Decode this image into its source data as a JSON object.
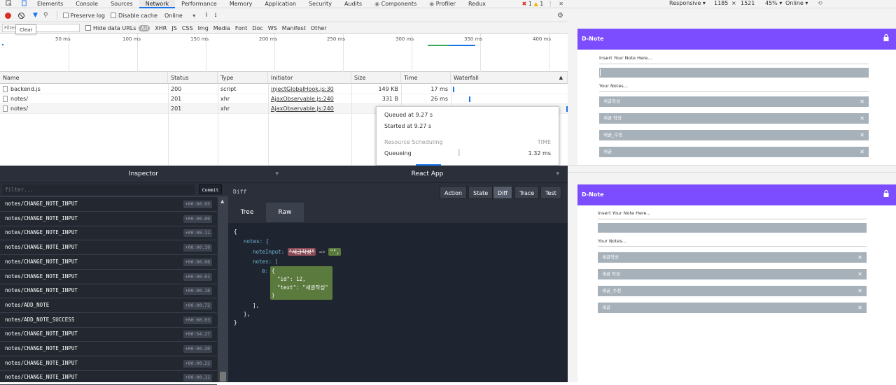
{
  "devtools": {
    "tabs": [
      "Elements",
      "Console",
      "Sources",
      "Network",
      "Performance",
      "Memory",
      "Application",
      "Security",
      "Audits",
      "Components",
      "Profiler",
      "Redux"
    ],
    "active_tab": "Network",
    "errors": "1",
    "warnings": "1",
    "toolbar": {
      "preserve_log": "Preserve log",
      "disable_cache": "Disable cache",
      "throttle": "Online",
      "clear_tooltip": "Clear"
    },
    "filter": {
      "placeholder": "Filter",
      "hide_data_urls": "Hide data URLs",
      "types": [
        "All",
        "XHR",
        "JS",
        "CSS",
        "Img",
        "Media",
        "Font",
        "Doc",
        "WS",
        "Manifest",
        "Other"
      ]
    },
    "overview_ticks": [
      "50 ms",
      "100 ms",
      "150 ms",
      "200 ms",
      "250 ms",
      "300 ms",
      "350 ms",
      "400 ms"
    ],
    "columns": [
      "Name",
      "Status",
      "Type",
      "Initiator",
      "Size",
      "Time",
      "Waterfall"
    ],
    "rows": [
      {
        "name": "backend.js",
        "status": "200",
        "type": "script",
        "initiator": "injectGlobalHook.js:30",
        "size": "149 KB",
        "time": "17 ms"
      },
      {
        "name": "notes/",
        "status": "201",
        "type": "xhr",
        "initiator": "AjaxObservable.js:240",
        "size": "331 B",
        "time": "26 ms"
      },
      {
        "name": "notes/",
        "status": "201",
        "type": "xhr",
        "initiator": "AjaxObservable.js:240",
        "size": "",
        "time": ""
      }
    ],
    "tooltip": {
      "queued": "Queued at 9.27 s",
      "started": "Started at 9.27 s",
      "section": "Resource Scheduling",
      "time_label": "TIME",
      "queueing": "Queueing",
      "queueing_time": "1.32 ms"
    }
  },
  "redux": {
    "inspector_title": "Inspector",
    "app_title": "React App",
    "filter_placeholder": "filter...",
    "commit": "Commit",
    "actions": [
      {
        "name": "notes/CHANGE_NOTE_INPUT",
        "time": "+00:00.05"
      },
      {
        "name": "notes/CHANGE_NOTE_INPUT",
        "time": "+00:00.09"
      },
      {
        "name": "notes/CHANGE_NOTE_INPUT",
        "time": "+00:00.11"
      },
      {
        "name": "notes/CHANGE_NOTE_INPUT",
        "time": "+00:00.19"
      },
      {
        "name": "notes/CHANGE_NOTE_INPUT",
        "time": "+00:00.08"
      },
      {
        "name": "notes/CHANGE_NOTE_INPUT",
        "time": "+00:00.01"
      },
      {
        "name": "notes/CHANGE_NOTE_INPUT",
        "time": "+00:00.18"
      },
      {
        "name": "notes/ADD_NOTE",
        "time": "+00:00.72"
      },
      {
        "name": "notes/ADD_NOTE_SUCCESS",
        "time": "+00:00.03"
      },
      {
        "name": "notes/CHANGE_NOTE_INPUT",
        "time": "+00:54.27"
      },
      {
        "name": "notes/CHANGE_NOTE_INPUT",
        "time": "+00:00.20"
      },
      {
        "name": "notes/CHANGE_NOTE_INPUT",
        "time": "+00:00.22"
      },
      {
        "name": "notes/CHANGE_NOTE_INPUT",
        "time": "+00:00.11"
      }
    ],
    "diff_label": "Diff",
    "monitor_buttons": [
      "Action",
      "State",
      "Diff",
      "Trace",
      "Test"
    ],
    "active_monitor": "Diff",
    "subtabs": [
      "Tree",
      "Raw"
    ],
    "active_subtab": "Raw",
    "json": {
      "open": "{",
      "notes_key": "notes: {",
      "note_input_key": "noteInput:",
      "old_value": "\"새글작성\"",
      "arrow": "=>",
      "new_value": "\"\",",
      "notes_arr": "notes: [",
      "idx": "0:",
      "obj_open": "{",
      "id_line": "\"id\": 12,",
      "text_line": "\"text\": \"새글작성\"",
      "obj_close": "}",
      "arr_close": "],",
      "notes_close": "},",
      "close": "}"
    }
  },
  "device_toolbar": {
    "mode": "Responsive",
    "width": "1185",
    "x": "×",
    "height": "1521",
    "zoom": "45%",
    "network": "Online"
  },
  "app": {
    "title": "D-Note",
    "insert_label": "Insert Your Note Here...",
    "your_notes": "Your Notes...",
    "notes_top": [
      "새글작성",
      "새글 작성",
      "새글_수정",
      "새글"
    ],
    "notes_bottom": [
      "새글작성",
      "새글 작성",
      "새글_수정",
      "새글"
    ]
  },
  "colors": {
    "accent": "#7c4dff",
    "note_bg": "#a7b1ba",
    "redux_bg": "#2a2f3a",
    "json_key": "#6fb3d2",
    "json_removed": "#8a4a56",
    "json_added": "#5b7a3e"
  }
}
